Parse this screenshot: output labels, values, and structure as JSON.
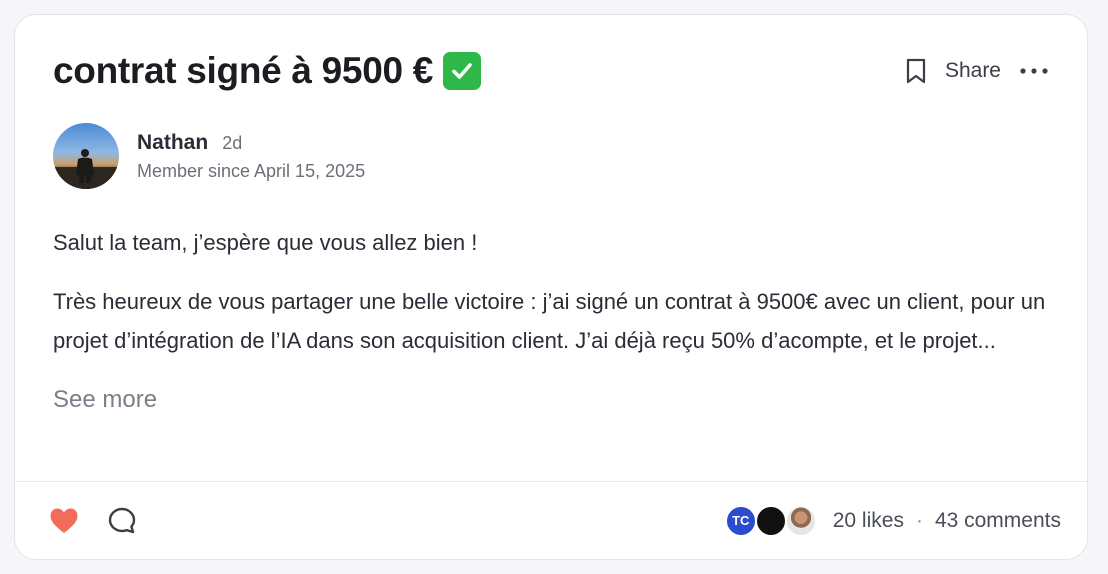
{
  "post": {
    "title": "contrat signé à 9500 €",
    "title_emoji": "check-mark-button-icon",
    "actions": {
      "share_label": "Share"
    },
    "author": {
      "name": "Nathan",
      "time": "2d",
      "member_since": "Member since April 15, 2025"
    },
    "body": {
      "paragraph_1": "Salut la team, j’espère que vous allez bien !",
      "paragraph_2": "Très heureux de vous partager une belle victoire : j’ai signé un contrat à 9500€ avec un client, pour un projet d’intégration de l’IA dans son acquisition client. J’ai déjà reçu 50% d’acompte, et le projet...",
      "see_more": "See more"
    },
    "footer": {
      "liker_initials": "TC",
      "likes": "20 likes",
      "separator": "·",
      "comments": "43 comments"
    }
  },
  "colors": {
    "heart": "#f26b5b",
    "liker_tc": "#2b4ccf",
    "check_emoji_bg": "#2fb84a"
  }
}
